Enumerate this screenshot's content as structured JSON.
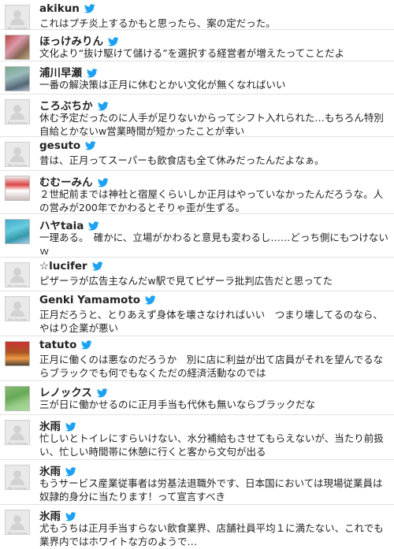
{
  "avatar_placeholder": "No Image",
  "twitter_color": "#1da1f2",
  "tweets": [
    {
      "user": "akikun",
      "text": "これはプチ炎上するかもと思ったら、案の定だった。",
      "avatar": "none"
    },
    {
      "user": "ほっけみりん",
      "text": "文化より“抜け駆けて儲ける”を選択する経営者が増えたってことだよ",
      "avatar": "photo"
    },
    {
      "user": "浦川早瀬",
      "text": "一番の解決策は正月に休むとかい文化が無くなればいい",
      "avatar": "photo"
    },
    {
      "user": "ころぶちか",
      "text": "休む予定だったのに人手が足りないからってシフト入れられた…もちろん特別自給とかないw営業時間が短かったことが幸い",
      "avatar": "none"
    },
    {
      "user": "gesuto",
      "text": "昔は、正月ってスーパーも飲食店も全て休みだったんだよなぁ。",
      "avatar": "none"
    },
    {
      "user": "むむーみん",
      "text": "２世紀前までは神社と宿屋くらいしか正月はやっていなかったんだろうな。人の営みが200年でかわるとそりゃ歪が生ずる。",
      "avatar": "photo"
    },
    {
      "user": "ハヤtaia",
      "text": "一理ある。　確かに、立場がかわると意見も変わるし……どっち側にもつけないｗ",
      "avatar": "photo"
    },
    {
      "user": "☆lucifer",
      "text": "ピザーラが広告主なんだw駅で見てピザーラ批判広告だと思ってた",
      "avatar": "none"
    },
    {
      "user": "Genki Yamamoto",
      "text": "正月だろうと、とりあえず身体を壊さなければいい　つまり壊してるのなら、やはり企業が悪い",
      "avatar": "none"
    },
    {
      "user": "tatuto",
      "text": "正月に働くのは悪なのだろうか　別に店に利益が出て店員がそれを望んでるならブラックでも何でもなくただの経済活動なのでは",
      "avatar": "photo"
    },
    {
      "user": "レノックス",
      "text": "三が日に働かせるのに正月手当も代休も無いならブラックだな",
      "avatar": "photo"
    },
    {
      "user": "氷雨",
      "text": "忙しいとトイレにすらいけない、水分補給もさせてもらえないが、当たり前扱い、忙しい時間帯に休憩に行くと客から文句が出る",
      "avatar": "none"
    },
    {
      "user": "氷雨",
      "text": "もうサービス産業従事者は労基法退職外です、日本国においては現場従業員は奴隷的身分に当たります！って宣言すべき",
      "avatar": "none"
    },
    {
      "user": "氷雨",
      "text": "尤もうちは正月手当すらない飲食業界、店舗社員平均１に満たない、これでも業界内ではホワイトな方のようで…",
      "avatar": "none"
    }
  ]
}
